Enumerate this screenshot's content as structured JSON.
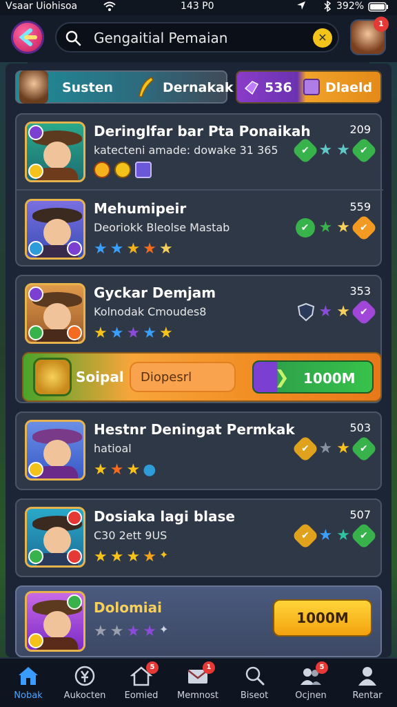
{
  "status_bar": {
    "left": "Vsaar Uiohisoa",
    "time": "143 P0",
    "right": "392%"
  },
  "header": {
    "search_value": "Gengaitial Pemaian",
    "avatar_badge": "1"
  },
  "tabs": {
    "left_label_1": "Susten",
    "left_label_2": "Dernakak",
    "right_value_1": "536",
    "right_value_2": "Dlaeld"
  },
  "cards": [
    {
      "rows": [
        {
          "title": "Deringlfar bar Pta Ponaikah",
          "subtitle": "katecteni amade: dowake 31 365",
          "score": "209",
          "rating": [
            "check-green-icon",
            "star-teal",
            "star-teal",
            "check-green-icon"
          ],
          "minis": [
            "#f5b21e",
            "#f3c31b",
            "#6a58d8"
          ]
        },
        {
          "title": "Mehumipeir",
          "subtitle": "Deoriokk Bleolse Mastab",
          "score": "559",
          "rating": [
            "check-green-icon",
            "star-green",
            "star-yellow",
            "check-orange-icon"
          ],
          "stars": [
            "#3aa0ff",
            "#3aa0ff",
            "#f2b21d",
            "#f26b21",
            "#f6d05a"
          ]
        }
      ]
    },
    {
      "rows": [
        {
          "title": "Gyckar Demjam",
          "subtitle": "Kolnodak Cmoudes8",
          "score": "353",
          "rating": [
            "shield-icon",
            "star-purple",
            "star-yellow",
            "check-purple-icon"
          ],
          "stars": [
            "#f6c21b",
            "#3aa0ff",
            "#8a4cd8",
            "#3aa0ff",
            "#f6c21b"
          ]
        }
      ]
    },
    {
      "rows": [
        {
          "title": "Hestnr Deningat Permkak",
          "subtitle": "hatioal",
          "score": "503",
          "rating": [
            "check-yellow-icon",
            "star-grey",
            "star-yellow",
            "check-green-icon"
          ],
          "stars": [
            "#f6c21b",
            "#f26b21",
            "#f6c21b",
            "#2e9cd8"
          ]
        }
      ]
    },
    {
      "rows": [
        {
          "title": "Dosiaka lagi blase",
          "subtitle": "C30 2ett 9US",
          "score": "507",
          "rating": [
            "check-yellow-icon",
            "star-teal",
            "star-teal",
            "check-green-icon"
          ],
          "stars": [
            "#f6c21b",
            "#f6c21b",
            "#f6c21b",
            "#f2a21d",
            "#f6c21b"
          ]
        }
      ]
    }
  ],
  "promo": {
    "label": "Soipal",
    "field_value": "Diopesrl",
    "cta_label": "1000M"
  },
  "last_card": {
    "title": "Dolomiai",
    "button_label": "1000M"
  },
  "nav": [
    {
      "label": "Nobak",
      "icon": "home-icon",
      "active": true
    },
    {
      "label": "Aukocten",
      "icon": "coin-icon",
      "active": false
    },
    {
      "label": "Eomied",
      "icon": "house-icon",
      "active": false,
      "badge": "5"
    },
    {
      "label": "Memnost",
      "icon": "mail-icon",
      "active": false,
      "badge": "1"
    },
    {
      "label": "Biseot",
      "icon": "search-icon",
      "active": false
    },
    {
      "label": "Ocjnen",
      "icon": "friends-icon",
      "active": false,
      "badge": "5"
    },
    {
      "label": "Rentar",
      "icon": "profile-icon",
      "active": false
    }
  ]
}
